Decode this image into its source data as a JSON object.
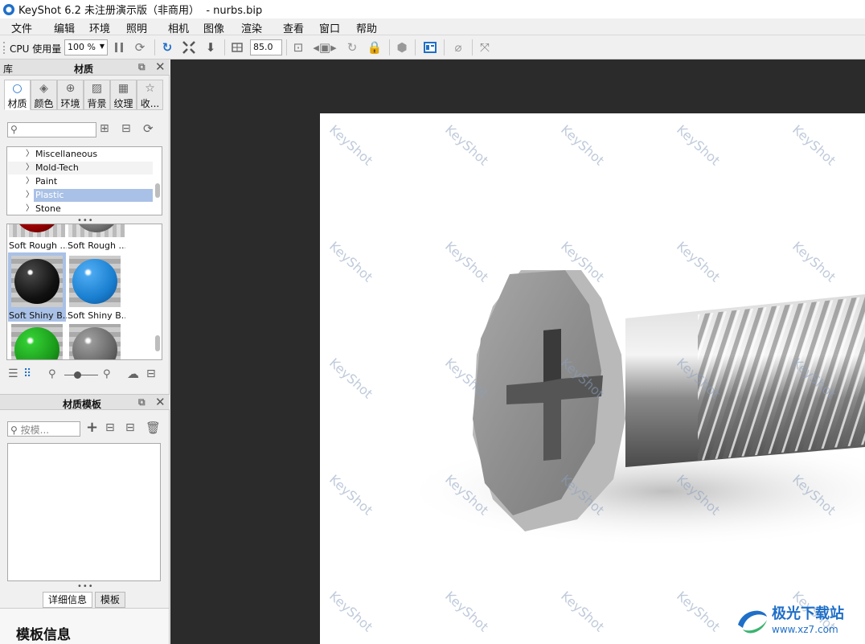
{
  "window": {
    "title": "KeyShot 6.2 未注册演示版（非商用）  - nurbs.bip"
  },
  "menu": [
    "文件",
    "编辑",
    "环境",
    "照明",
    "相机",
    "图像",
    "渲染",
    "查看",
    "窗口",
    "帮助"
  ],
  "toolbar": {
    "cpu_label": "CPU 使用量",
    "cpu_value": "100 %",
    "fov_value": "85.0"
  },
  "library": {
    "header_left": "库",
    "header_title": "材质",
    "tabs": [
      {
        "label": "材质",
        "icon": "material-icon"
      },
      {
        "label": "颜色",
        "icon": "color-icon"
      },
      {
        "label": "环境",
        "icon": "environment-icon"
      },
      {
        "label": "背景",
        "icon": "background-icon"
      },
      {
        "label": "纹理",
        "icon": "texture-icon"
      },
      {
        "label": "收...",
        "icon": "favorites-icon"
      }
    ],
    "search_placeholder": "",
    "tree": [
      "Miscellaneous",
      "Mold-Tech",
      "Paint",
      "Plastic",
      "Stone"
    ],
    "selected_tree": "Plastic",
    "thumbs": [
      "Soft Rough ...",
      "Soft Rough ...",
      "Soft Shiny B...",
      "Soft Shiny B..."
    ]
  },
  "template": {
    "header_title": "材质模板",
    "search_placeholder": "按模...",
    "bottom_tabs": [
      "详细信息",
      "模板"
    ],
    "info_title": "模板信息"
  },
  "viewport": {
    "watermark": "KeyShot"
  },
  "brand": {
    "cn": "极光下载站",
    "url": "www.xz7.com"
  },
  "colors": {
    "accent": "#1f6fc8",
    "selection": "#a9c1e6"
  }
}
